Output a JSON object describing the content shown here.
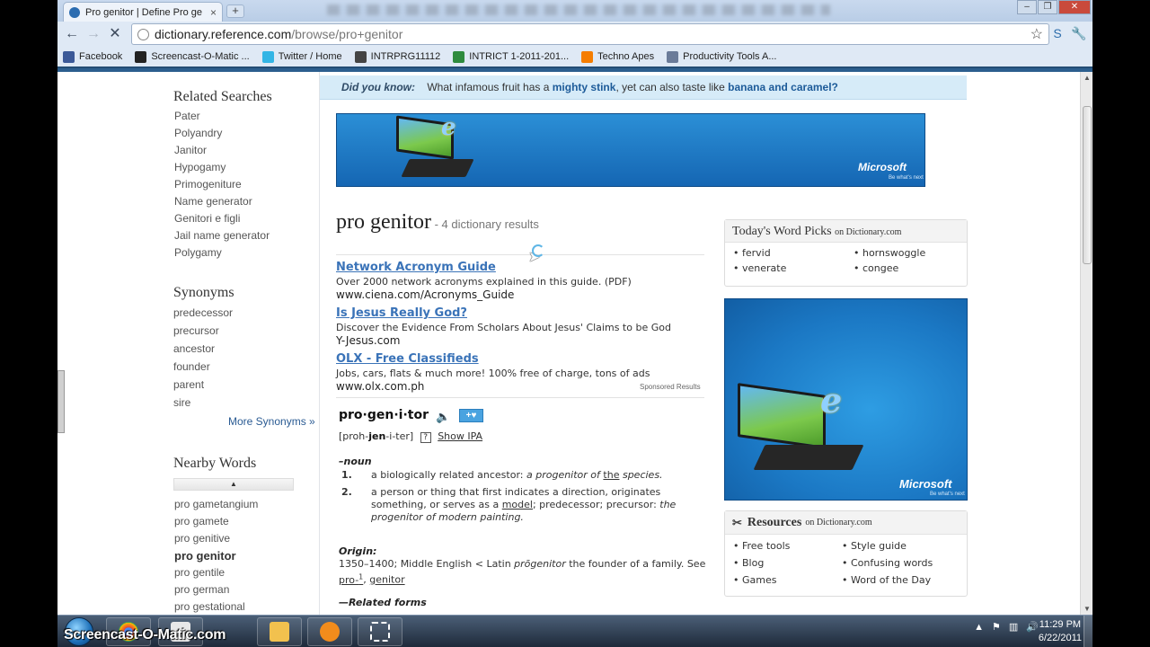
{
  "browser": {
    "tab_title": "Pro genitor | Define Pro ge",
    "tab_close": "×",
    "new_tab": "+",
    "url_host": "dictionary.reference.com",
    "url_path": "/browse/pro+genitor",
    "bookmarks": [
      {
        "label": "Facebook",
        "color": "#3b5998"
      },
      {
        "label": "Screencast-O-Matic ...",
        "color": "#222222"
      },
      {
        "label": "Twitter / Home",
        "color": "#33b5e5"
      },
      {
        "label": "INTRPRG11112",
        "color": "#444444"
      },
      {
        "label": "INTRICT 1-2011-201...",
        "color": "#2e8b3e"
      },
      {
        "label": "Techno Apes",
        "color": "#f57d00"
      },
      {
        "label": "Productivity Tools A...",
        "color": "#6a7b99"
      }
    ]
  },
  "sidebar": {
    "related_title": "Related Searches",
    "related": [
      "Pater",
      "Polyandry",
      "Janitor",
      "Hypogamy",
      "Primogeniture",
      "Name generator",
      "Genitori e figli",
      "Jail name generator",
      "Polygamy"
    ],
    "synonyms_title": "Synonyms",
    "synonyms": [
      "predecessor",
      "precursor",
      "ancestor",
      "founder",
      "parent",
      "sire"
    ],
    "more_synonyms": "More Synonyms »",
    "nearby_title": "Nearby Words",
    "nearby": [
      "pro gametangium",
      "pro gamete",
      "pro genitive",
      "pro genitor",
      "pro gentile",
      "pro german",
      "pro gestational"
    ]
  },
  "dyk": {
    "label": "Did you know:",
    "q1": "What infamous fruit has a ",
    "b1": "mighty stink",
    "q2": ", yet can also taste like ",
    "b2": "banana and caramel?"
  },
  "ads": {
    "brand": "Microsoft",
    "tagline": "Be what's next"
  },
  "result": {
    "term": "pro genitor",
    "count": " - 4 dictionary results",
    "sponsored": [
      {
        "title": "Network Acronym Guide",
        "desc": "Over 2000 network acronyms explained in this guide. (PDF)",
        "url": "www.ciena.com/Acronyms_Guide"
      },
      {
        "title": "Is Jesus Really God?",
        "desc": "Discover the Evidence From Scholars About Jesus' Claims to be God",
        "url": "Y-Jesus.com"
      },
      {
        "title": "OLX - Free Classifieds",
        "desc": "Jobs, cars, flats & much more! 100% free of charge, tons of ads",
        "url": "www.olx.com.ph"
      }
    ],
    "sponsored_label": "Sponsored Results",
    "headword": "pro·gen·i·tor",
    "fav_btn": "+♥",
    "pron_open": "[proh-",
    "pron_bold": "jen",
    "pron_close": "-i-ter]",
    "ipa_q": "?",
    "show_ipa": "Show IPA",
    "pos": "–noun",
    "def1_num": "1.",
    "def1_a": "a biologically related ancestor: ",
    "def1_i1": "a progenitor of ",
    "def1_u": "the",
    "def1_i2": " species.",
    "def2_num": "2.",
    "def2_a": "a person or thing that first indicates a direction, originates something, or serves as a ",
    "def2_u": "model",
    "def2_b": "; predecessor; precursor: ",
    "def2_i": "the progenitor of modern painting.",
    "origin_title": "Origin:",
    "origin_a": "1350–1400; Middle English  < Latin ",
    "origin_i": "prōgenitor",
    "origin_b": "  the founder of a family. See ",
    "origin_u1": "pro-",
    "origin_sup": "1",
    "origin_comma": ", ",
    "origin_u2": "genitor",
    "related_forms": "—Related forms"
  },
  "word_picks": {
    "title": "Today's Word Picks",
    "on": "on Dictionary.com",
    "words": [
      "• fervid",
      "• hornswoggle",
      "• venerate",
      "• congee"
    ]
  },
  "resources": {
    "title": "Resources",
    "on": "on Dictionary.com",
    "items": [
      "• Free tools",
      "• Style guide",
      "• Blog",
      "• Confusing words",
      "• Games",
      "• Word of the Day"
    ]
  },
  "taskbar": {
    "watermark": "Screencast-O-Matic.com",
    "time": "11:29 PM",
    "date": "6/22/2011"
  }
}
